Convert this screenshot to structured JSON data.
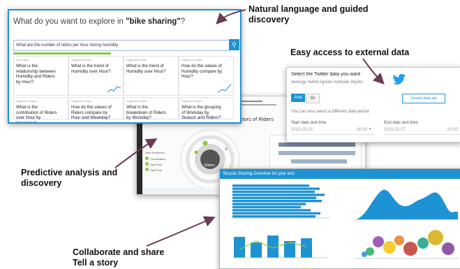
{
  "callouts": {
    "natural_language": "Natural language and guided discovery",
    "external_data": "Easy access to external data",
    "predictive": "Predictive analysis and discovery",
    "collaborate": "Collaborate and share Tell a story"
  },
  "explore": {
    "title_prefix": "What do you want to explore in ",
    "title_subject": "\"bike sharing\"",
    "title_suffix": "?",
    "search_value": "What are the number of riders per hour during humidity",
    "search_icon": "search-icon",
    "cards": [
      {
        "tag": "Key Insight",
        "question": "What is the relationship between Humidity and Riders by Hour?"
      },
      {
        "tag": "Suggested Insight",
        "question": "What is the trend of Humidity over Hour?"
      },
      {
        "tag": "Suggested Insight",
        "question": "How do the values of Humidity compare by Hour?"
      },
      {
        "tag": "Suggested Insight",
        "question": "What is the contribution of Riders over Hour by Weekday?"
      },
      {
        "tag": "Suggested Insight",
        "question": "How do the values of Riders compare by Hour and Weekday?"
      },
      {
        "tag": "Suggested Insight",
        "question": "What is the breakdown of Riders by Workday?"
      },
      {
        "tag": "Suggested Insight",
        "question": "What is the grouping of Workday by Season and Riders?"
      }
    ]
  },
  "twitter": {
    "heading": "Select the Twitter data you want",
    "tags": "#energy #wind #green #climate #kyoto",
    "and_label": "And",
    "or_label": "Or",
    "create_label": "Create data set",
    "alt_text": "You can also select a different date period",
    "start_label": "Start date and time",
    "start_date": "2015-03-20",
    "start_time": "00:00",
    "end_label": "End date and time",
    "end_date": "2015-03-27",
    "end_time": "00:00"
  },
  "predict": {
    "header": "ictors of Riders",
    "center_label": "Riders",
    "list_title": "Main Predictors",
    "list_items": [
      "Combination",
      "Day Field",
      "Day Field"
    ]
  },
  "dashboard": {
    "title": "Bicycle Sharing Overview for year end"
  },
  "colors": {
    "accent": "#1e93d3",
    "green": "#8cc63f"
  }
}
